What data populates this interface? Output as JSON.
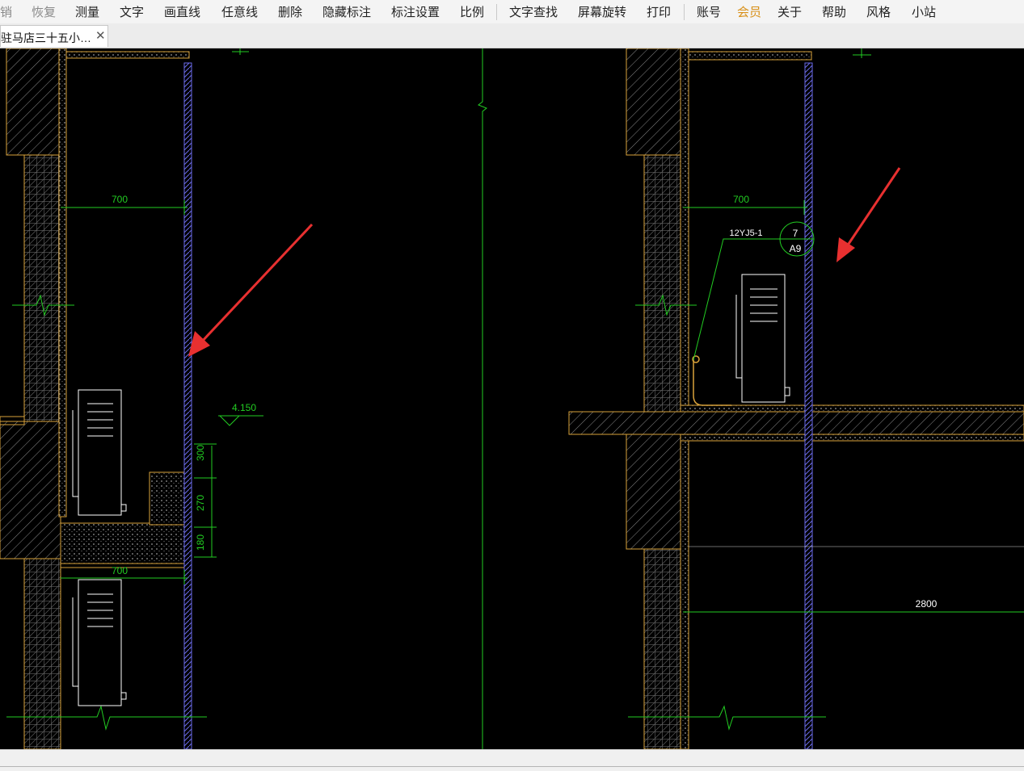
{
  "toolbar": {
    "items": [
      {
        "label": "销",
        "state": "disabled"
      },
      {
        "label": "恢复",
        "state": "disabled"
      },
      {
        "label": "测量",
        "state": "normal"
      },
      {
        "label": "文字",
        "state": "normal"
      },
      {
        "label": "画直线",
        "state": "normal"
      },
      {
        "label": "任意线",
        "state": "normal"
      },
      {
        "label": "删除",
        "state": "normal"
      },
      {
        "label": "隐藏标注",
        "state": "normal"
      },
      {
        "label": "标注设置",
        "state": "normal"
      },
      {
        "label": "比例",
        "state": "normal"
      },
      {
        "label": "文字查找",
        "state": "normal"
      },
      {
        "label": "屏幕旋转",
        "state": "normal"
      },
      {
        "label": "打印",
        "state": "normal"
      },
      {
        "label": "账号",
        "state": "normal"
      },
      {
        "label": "会员",
        "state": "vip"
      },
      {
        "label": "关于",
        "state": "normal"
      },
      {
        "label": "帮助",
        "state": "normal"
      },
      {
        "label": "风格",
        "state": "normal"
      },
      {
        "label": "小站",
        "state": "normal"
      }
    ]
  },
  "tab": {
    "title": "驻马店三十五小…",
    "close_glyph": "✕"
  },
  "drawing": {
    "background": "#000000",
    "colors": {
      "wall_outline": "#d9a23a",
      "dimension": "#22cc22",
      "glass": "#6a6ae8",
      "annotation_arrow": "#e83030",
      "equipment": "#ffffff"
    },
    "left_detail": {
      "dim_upper": "700",
      "dim_lower": "700",
      "level": "4.150",
      "dim_stack": [
        "300",
        "270",
        "180"
      ]
    },
    "right_detail": {
      "dim_top": "700",
      "ref_code": "12YJ5-1",
      "ref_symbol_top": "7",
      "ref_symbol_bottom": "A9",
      "dim_bottom": "2800"
    }
  }
}
